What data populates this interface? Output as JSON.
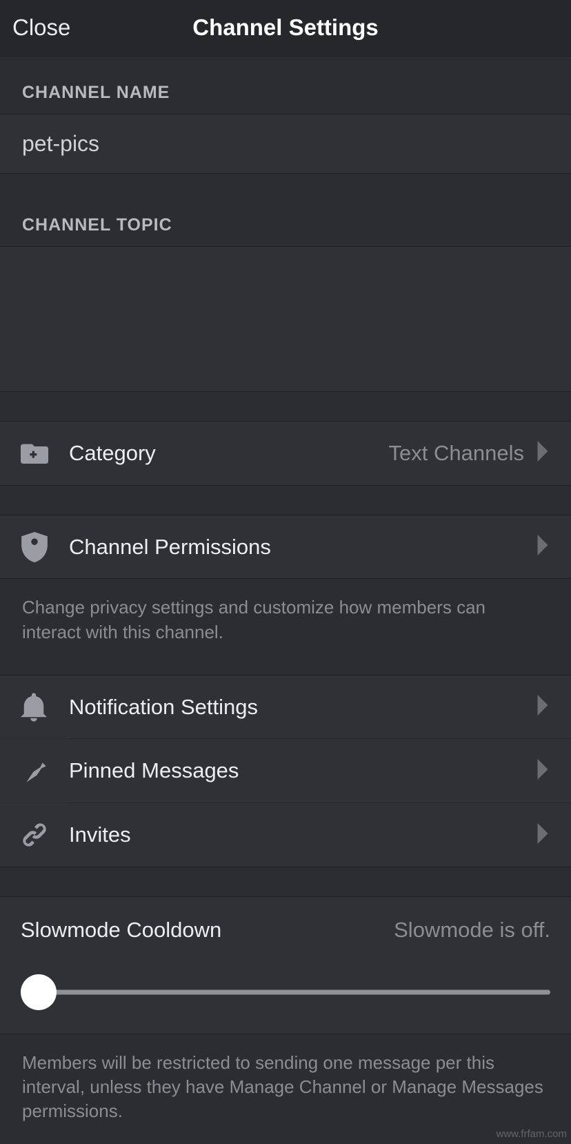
{
  "header": {
    "close": "Close",
    "title": "Channel Settings"
  },
  "sections": {
    "channel_name_label": "CHANNEL NAME",
    "channel_name_value": "pet-pics",
    "channel_topic_label": "CHANNEL TOPIC"
  },
  "rows": {
    "category": {
      "label": "Category",
      "value": "Text Channels"
    },
    "permissions": {
      "label": "Channel Permissions"
    },
    "permissions_help": "Change privacy settings and customize how members can interact with this channel.",
    "notifications": {
      "label": "Notification Settings"
    },
    "pinned": {
      "label": "Pinned Messages"
    },
    "invites": {
      "label": "Invites"
    }
  },
  "slowmode": {
    "title": "Slowmode Cooldown",
    "status": "Slowmode is off.",
    "value_seconds": 0,
    "help": "Members will be restricted to sending one message per this interval, unless they have Manage Channel or Manage Messages permissions."
  },
  "watermark": "www.frfam.com"
}
